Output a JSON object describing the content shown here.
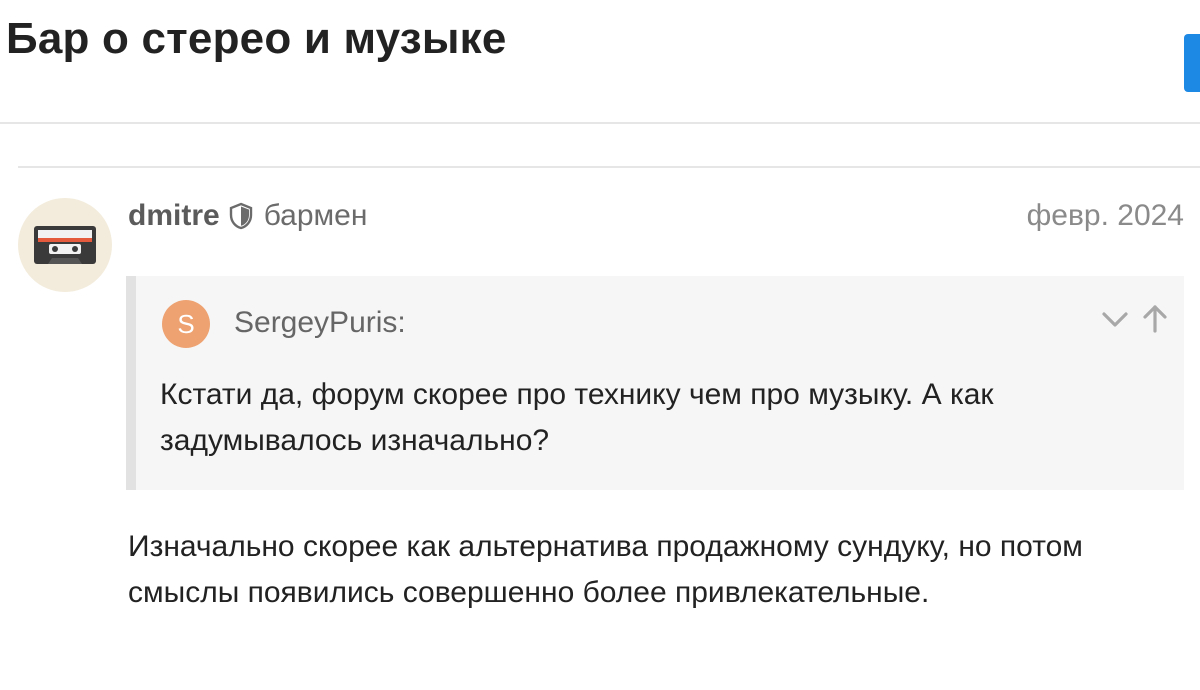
{
  "topic": {
    "title": "Бар о стерео и музыке"
  },
  "post": {
    "avatar_icon": "cassette-tape-icon",
    "username": "dmitre",
    "moderator_icon": "shield-icon",
    "user_title": "бармен",
    "date": "февр. 2024",
    "quote": {
      "author_initial": "S",
      "author_avatar_color": "#eea271",
      "author": "SergeyPuris:",
      "expand_icon": "chevron-down-icon",
      "jump_icon": "arrow-up-icon",
      "text": "Кстати да, форум скорее про технику чем про музыку. А как задумывалось изначально?"
    },
    "body": "Изначально скорее как альтернатива продажному сундуку, но потом смыслы появились совершенно более привлекательные."
  },
  "colors": {
    "accent": "#1e88e5",
    "quote_background": "#f6f6f6",
    "quote_border": "#e2e2e2"
  }
}
